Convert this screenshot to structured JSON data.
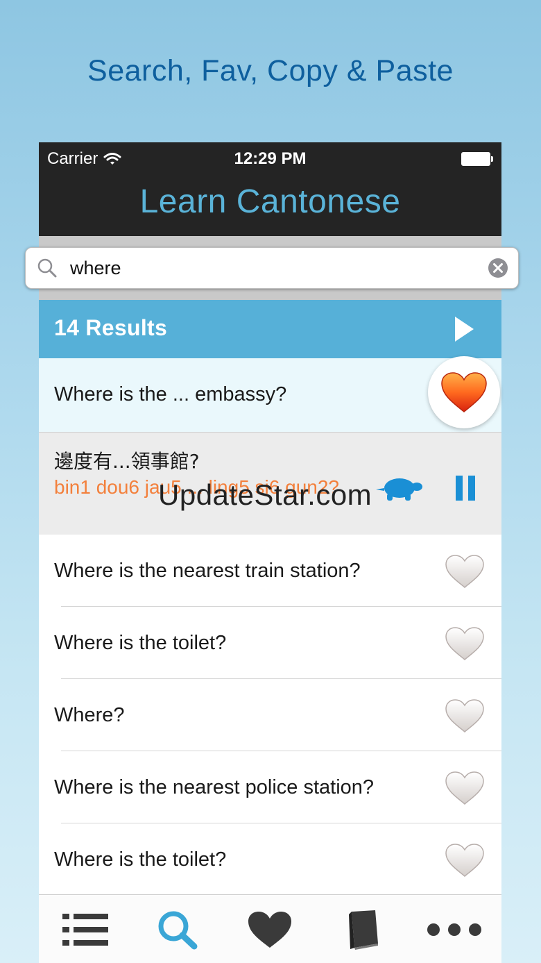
{
  "headline": "Search, Fav, Copy & Paste",
  "status_bar": {
    "carrier": "Carrier",
    "time": "12:29 PM"
  },
  "app": {
    "title": "Learn Cantonese"
  },
  "search": {
    "value": "where"
  },
  "results": {
    "label": "14 Results"
  },
  "selected_item": {
    "text": "Where is the ... embassy?",
    "favorited": true
  },
  "expanded_item": {
    "chinese": "邊度有...領事館?",
    "jyutping": "bin1 dou6 jau5 ... ling5 si6 gun2?",
    "watermark": "UpdateStar.com"
  },
  "items": [
    {
      "text": "Where is the nearest train station?",
      "favorited": false
    },
    {
      "text": "Where is the toilet?",
      "favorited": false
    },
    {
      "text": "Where?",
      "favorited": false
    },
    {
      "text": "Where is the nearest police station?",
      "favorited": false
    },
    {
      "text": "Where is the toilet?",
      "favorited": false
    }
  ],
  "tabs": [
    {
      "icon": "list-icon",
      "active": false
    },
    {
      "icon": "search-icon",
      "active": true
    },
    {
      "icon": "heart-icon",
      "active": false
    },
    {
      "icon": "book-icon",
      "active": false
    },
    {
      "icon": "more-icon",
      "active": false
    }
  ],
  "colors": {
    "headline": "#0e5f9e",
    "nav_bar": "#242424",
    "title": "#5ab3d8",
    "results_bar": "#56b0d8",
    "jyutping": "#f3803c",
    "tab_active": "#3aa6d6",
    "tab_inactive": "#3a3a3a"
  }
}
